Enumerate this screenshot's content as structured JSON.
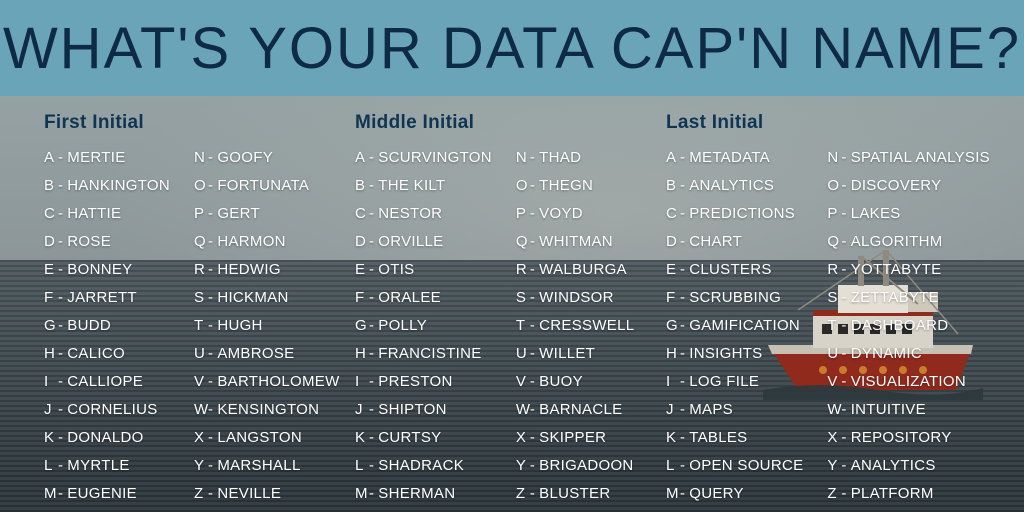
{
  "title": "WHAT'S YOUR DATA CAP'N NAME?",
  "dash": "-",
  "sections": [
    {
      "heading": "First Initial",
      "items": [
        {
          "l": "A",
          "v": "MERTIE"
        },
        {
          "l": "B",
          "v": "HANKINGTON"
        },
        {
          "l": "C",
          "v": "HATTIE"
        },
        {
          "l": "D",
          "v": "ROSE"
        },
        {
          "l": "E",
          "v": "BONNEY"
        },
        {
          "l": "F",
          "v": "JARRETT"
        },
        {
          "l": "G",
          "v": "BUDD"
        },
        {
          "l": "H",
          "v": "CALICO"
        },
        {
          "l": "I",
          "v": "CALLIOPE"
        },
        {
          "l": "J",
          "v": "CORNELIUS"
        },
        {
          "l": "K",
          "v": "DONALDO"
        },
        {
          "l": "L",
          "v": "MYRTLE"
        },
        {
          "l": "M",
          "v": "EUGENIE"
        },
        {
          "l": "N",
          "v": "GOOFY"
        },
        {
          "l": "O",
          "v": "FORTUNATA"
        },
        {
          "l": "P",
          "v": "GERT"
        },
        {
          "l": "Q",
          "v": "HARMON"
        },
        {
          "l": "R",
          "v": "HEDWIG"
        },
        {
          "l": "S",
          "v": "HICKMAN"
        },
        {
          "l": "T",
          "v": "HUGH"
        },
        {
          "l": "U",
          "v": "AMBROSE"
        },
        {
          "l": "V",
          "v": "BARTHOLOMEW"
        },
        {
          "l": "W",
          "v": "KENSINGTON"
        },
        {
          "l": "X",
          "v": "LANGSTON"
        },
        {
          "l": "Y",
          "v": "MARSHALL"
        },
        {
          "l": "Z",
          "v": "NEVILLE"
        }
      ]
    },
    {
      "heading": "Middle Initial",
      "items": [
        {
          "l": "A",
          "v": "SCURVINGTON"
        },
        {
          "l": "B",
          "v": "THE KILT"
        },
        {
          "l": "C",
          "v": "NESTOR"
        },
        {
          "l": "D",
          "v": "ORVILLE"
        },
        {
          "l": "E",
          "v": "OTIS"
        },
        {
          "l": "F",
          "v": "ORALEE"
        },
        {
          "l": "G",
          "v": "POLLY"
        },
        {
          "l": "H",
          "v": "FRANCISTINE"
        },
        {
          "l": "I",
          "v": "PRESTON"
        },
        {
          "l": "J",
          "v": "SHIPTON"
        },
        {
          "l": "K",
          "v": "CURTSY"
        },
        {
          "l": "L",
          "v": "SHADRACK"
        },
        {
          "l": "M",
          "v": "SHERMAN"
        },
        {
          "l": "N",
          "v": "THAD"
        },
        {
          "l": "O",
          "v": "THEGN"
        },
        {
          "l": "P",
          "v": "VOYD"
        },
        {
          "l": "Q",
          "v": "WHITMAN"
        },
        {
          "l": "R",
          "v": "WALBURGA"
        },
        {
          "l": "S",
          "v": "WINDSOR"
        },
        {
          "l": "T",
          "v": "CRESSWELL"
        },
        {
          "l": "U",
          "v": "WILLET"
        },
        {
          "l": "V",
          "v": "BUOY"
        },
        {
          "l": "W",
          "v": "BARNACLE"
        },
        {
          "l": "X",
          "v": "SKIPPER"
        },
        {
          "l": "Y",
          "v": "BRIGADOON"
        },
        {
          "l": "Z",
          "v": "BLUSTER"
        }
      ]
    },
    {
      "heading": "Last Initial",
      "items": [
        {
          "l": "A",
          "v": "METADATA"
        },
        {
          "l": "B",
          "v": "ANALYTICS"
        },
        {
          "l": "C",
          "v": "PREDICTIONS"
        },
        {
          "l": "D",
          "v": "CHART"
        },
        {
          "l": "E",
          "v": "CLUSTERS"
        },
        {
          "l": "F",
          "v": "SCRUBBING"
        },
        {
          "l": "G",
          "v": "GAMIFICATION"
        },
        {
          "l": "H",
          "v": "INSIGHTS"
        },
        {
          "l": "I",
          "v": "LOG FILE"
        },
        {
          "l": "J",
          "v": "MAPS"
        },
        {
          "l": "K",
          "v": "TABLES"
        },
        {
          "l": "L",
          "v": "OPEN SOURCE"
        },
        {
          "l": "M",
          "v": "QUERY"
        },
        {
          "l": "N",
          "v": "SPATIAL ANALYSIS"
        },
        {
          "l": "O",
          "v": "DISCOVERY"
        },
        {
          "l": "P",
          "v": "LAKES"
        },
        {
          "l": "Q",
          "v": "ALGORITHM"
        },
        {
          "l": "R",
          "v": "YOTTABYTE"
        },
        {
          "l": "S",
          "v": "ZETTABYTE"
        },
        {
          "l": "T",
          "v": "DASHBOARD"
        },
        {
          "l": "U",
          "v": "DYNAMIC"
        },
        {
          "l": "V",
          "v": "VISUALIZATION"
        },
        {
          "l": "W",
          "v": "INTUITIVE"
        },
        {
          "l": "X",
          "v": "REPOSITORY"
        },
        {
          "l": "Y",
          "v": "ANALYTICS"
        },
        {
          "l": "Z",
          "v": "PLATFORM"
        }
      ]
    }
  ]
}
